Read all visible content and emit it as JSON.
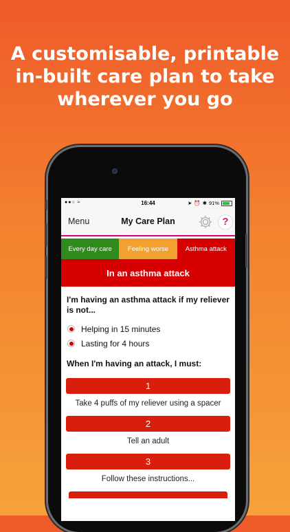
{
  "promo": {
    "lines": [
      "A customisable, printable",
      "in-built care plan to take",
      "wherever you go"
    ]
  },
  "status_bar": {
    "time": "16:44",
    "battery": "91%"
  },
  "nav": {
    "menu_label": "Menu",
    "title": "My Care Plan",
    "help_label": "?"
  },
  "tabs": [
    {
      "label": "Every day care",
      "color": "#2e8b1c"
    },
    {
      "label": "Feeling worse",
      "color": "#f2a030"
    },
    {
      "label": "Asthma attack",
      "color": "#d70000"
    }
  ],
  "banner": {
    "title": "In an asthma attack"
  },
  "content": {
    "intro": "I'm having an asthma attack if my reliever is not...",
    "conditions": [
      "Helping in 15 minutes",
      "Lasting for 4 hours"
    ],
    "must_heading": "When I'm having an attack, I must:",
    "steps": [
      {
        "number": "1",
        "text": "Take 4 puffs of my reliever using a spacer"
      },
      {
        "number": "2",
        "text": "Tell an adult"
      },
      {
        "number": "3",
        "text": "Follow these instructions..."
      }
    ]
  },
  "colors": {
    "accent_red": "#d70000",
    "step_red": "#d81f0e",
    "nav_underline": "#d9006c",
    "help_pink": "#d61b86"
  }
}
